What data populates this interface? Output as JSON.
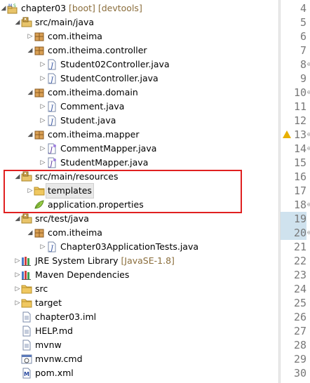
{
  "tree": [
    {
      "label": "chapter03",
      "decor": " [boot] [devtools]",
      "icon": "maven-project-icon",
      "twisty": "expanded",
      "indent": 0
    },
    {
      "label": "src/main/java",
      "icon": "source-folder-icon",
      "twisty": "expanded",
      "indent": 1
    },
    {
      "label": "com.itheima",
      "icon": "package-icon",
      "twisty": "collapsed",
      "indent": 2
    },
    {
      "label": "com.itheima.controller",
      "icon": "package-icon",
      "twisty": "expanded",
      "indent": 2
    },
    {
      "label": "Student02Controller.java",
      "icon": "java-file-icon",
      "twisty": "collapsed",
      "indent": 3
    },
    {
      "label": "StudentController.java",
      "icon": "java-file-icon",
      "twisty": "collapsed",
      "indent": 3
    },
    {
      "label": "com.itheima.domain",
      "icon": "package-icon",
      "twisty": "expanded",
      "indent": 2
    },
    {
      "label": "Comment.java",
      "icon": "java-file-icon",
      "twisty": "collapsed",
      "indent": 3
    },
    {
      "label": "Student.java",
      "icon": "java-file-icon",
      "twisty": "collapsed",
      "indent": 3
    },
    {
      "label": "com.itheima.mapper",
      "icon": "package-icon",
      "twisty": "expanded",
      "indent": 2
    },
    {
      "label": "CommentMapper.java",
      "icon": "java-interface-file-icon",
      "twisty": "collapsed",
      "indent": 3
    },
    {
      "label": "StudentMapper.java",
      "icon": "java-interface-file-icon",
      "twisty": "collapsed",
      "indent": 3
    },
    {
      "label": "src/main/resources",
      "icon": "resource-folder-icon",
      "twisty": "expanded",
      "indent": 1
    },
    {
      "label": "templates",
      "icon": "folder-icon",
      "twisty": "collapsed",
      "indent": 2,
      "selected": true
    },
    {
      "label": "application.properties",
      "icon": "properties-file-icon",
      "twisty": "none",
      "indent": 2
    },
    {
      "label": "src/test/java",
      "icon": "source-folder-icon",
      "twisty": "expanded",
      "indent": 1
    },
    {
      "label": "com.itheima",
      "icon": "package-icon",
      "twisty": "expanded",
      "indent": 2
    },
    {
      "label": "Chapter03ApplicationTests.java",
      "icon": "java-file-icon",
      "twisty": "collapsed",
      "indent": 3
    },
    {
      "label": "JRE System Library",
      "decor": " [JavaSE-1.8]",
      "icon": "library-icon",
      "twisty": "collapsed",
      "indent": 1
    },
    {
      "label": "Maven Dependencies",
      "icon": "library-icon",
      "twisty": "collapsed",
      "indent": 1
    },
    {
      "label": "src",
      "icon": "folder-icon",
      "twisty": "collapsed",
      "indent": 1
    },
    {
      "label": "target",
      "icon": "folder-icon",
      "twisty": "collapsed",
      "indent": 1
    },
    {
      "label": "chapter03.iml",
      "icon": "text-file-icon",
      "twisty": "none",
      "indent": 1
    },
    {
      "label": "HELP.md",
      "icon": "text-file-icon",
      "twisty": "none",
      "indent": 1
    },
    {
      "label": "mvnw",
      "icon": "text-file-icon",
      "twisty": "none",
      "indent": 1
    },
    {
      "label": "mvnw.cmd",
      "icon": "cmd-file-icon",
      "twisty": "none",
      "indent": 1
    },
    {
      "label": "pom.xml",
      "icon": "maven-pom-icon",
      "twisty": "none",
      "indent": 1
    }
  ],
  "line_numbers": [
    {
      "n": "4"
    },
    {
      "n": "5"
    },
    {
      "n": "6"
    },
    {
      "n": "7"
    },
    {
      "n": "8",
      "fold": "⊖"
    },
    {
      "n": "9"
    },
    {
      "n": "10",
      "fold": "⊖"
    },
    {
      "n": "11"
    },
    {
      "n": "12"
    },
    {
      "n": "13",
      "fold": "⊖",
      "warning": true
    },
    {
      "n": "14",
      "fold": "⊖"
    },
    {
      "n": "15"
    },
    {
      "n": "16"
    },
    {
      "n": "17"
    },
    {
      "n": "18",
      "fold": "⊖"
    },
    {
      "n": "19",
      "highlight": true
    },
    {
      "n": "20",
      "fold": "⊖",
      "highlight": true
    },
    {
      "n": "21"
    },
    {
      "n": "22"
    },
    {
      "n": "23"
    },
    {
      "n": "24"
    },
    {
      "n": "25"
    },
    {
      "n": "26"
    },
    {
      "n": "27"
    },
    {
      "n": "28"
    },
    {
      "n": "29"
    },
    {
      "n": "30"
    }
  ],
  "colors": {
    "highlight_box": "#e02020",
    "selection": "#e8e8e8",
    "line_highlight": "#cfe2ee",
    "decoration": "#8a6d3b"
  }
}
